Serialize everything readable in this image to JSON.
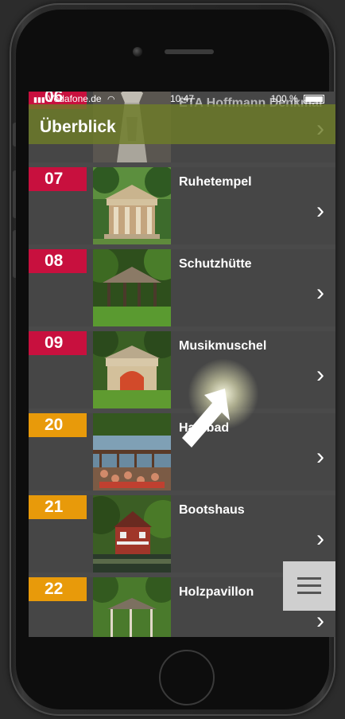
{
  "status": {
    "carrier": "Vodafone.de",
    "time": "10:47",
    "battery": "100 %"
  },
  "nav": {
    "title": "Überblick"
  },
  "items": [
    {
      "number": "06",
      "label": "ETA Hoffmann Denkmal",
      "color": "#c8103e"
    },
    {
      "number": "07",
      "label": "Ruhetempel",
      "color": "#c8103e"
    },
    {
      "number": "08",
      "label": "Schutzhütte",
      "color": "#c8103e"
    },
    {
      "number": "09",
      "label": "Musikmuschel",
      "color": "#c8103e"
    },
    {
      "number": "20",
      "label": "Hainbad",
      "color": "#e89a0a"
    },
    {
      "number": "21",
      "label": "Bootshaus",
      "color": "#e89a0a"
    },
    {
      "number": "22",
      "label": "Holzpavillon",
      "color": "#e89a0a"
    }
  ],
  "icons": {
    "wifi": "wifi-icon",
    "battery": "battery-icon",
    "chevron": "chevron-right-icon",
    "menu": "hamburger-menu-icon",
    "pointer": "arrow-pointer-icon"
  }
}
